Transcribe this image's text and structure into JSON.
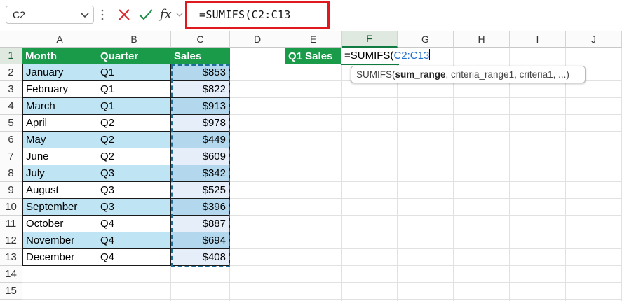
{
  "formula_bar": {
    "name_box": "C2",
    "cancel_icon": "close-x-icon",
    "enter_icon": "checkmark-icon",
    "fx_label": "fx",
    "formula": "=SUMIFS(C2:C13"
  },
  "columns": [
    "A",
    "B",
    "C",
    "D",
    "E",
    "F",
    "G",
    "H",
    "I",
    "J"
  ],
  "active_column": "F",
  "rows": [
    "1",
    "2",
    "3",
    "4",
    "5",
    "6",
    "7",
    "8",
    "9",
    "10",
    "11",
    "12",
    "13",
    "14",
    "15"
  ],
  "active_row": "1",
  "table": {
    "headers": [
      "Month",
      "Quarter",
      "Sales"
    ],
    "rows": [
      [
        "January",
        "Q1",
        "$853"
      ],
      [
        "February",
        "Q1",
        "$822"
      ],
      [
        "March",
        "Q1",
        "$913"
      ],
      [
        "April",
        "Q2",
        "$978"
      ],
      [
        "May",
        "Q2",
        "$449"
      ],
      [
        "June",
        "Q2",
        "$609"
      ],
      [
        "July",
        "Q3",
        "$342"
      ],
      [
        "August",
        "Q3",
        "$525"
      ],
      [
        "September",
        "Q3",
        "$396"
      ],
      [
        "October",
        "Q4",
        "$887"
      ],
      [
        "November",
        "Q4",
        "$694"
      ],
      [
        "December",
        "Q4",
        "$408"
      ]
    ]
  },
  "summary": {
    "label": "Q1 Sales",
    "edit_prefix": "=SUMIFS(",
    "edit_ref": "C2:C13"
  },
  "tooltip": {
    "func": "SUMIFS(",
    "arg_bold": "sum_range",
    "rest": ", criteria_range1, criteria1, ...)"
  },
  "colors": {
    "header_green": "#1a9b4a",
    "band_blue": "#bfe4f4",
    "highlight_red": "#e0191f",
    "reference_blue": "#1f6fd1"
  }
}
